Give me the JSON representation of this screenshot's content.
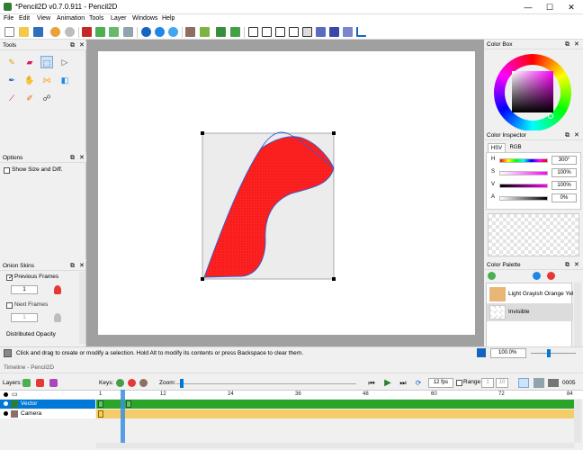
{
  "window": {
    "title": "*Pencil2D v0.7.0.911 - Pencil2D",
    "minimize": "—",
    "maximize": "☐",
    "close": "✕"
  },
  "menu": {
    "items": [
      "File",
      "Edit",
      "View",
      "Animation",
      "Tools",
      "Layer",
      "Windows",
      "Help"
    ]
  },
  "toolbar": {
    "icons": [
      "new-file-icon",
      "open-file-icon",
      "save-icon",
      "undo-icon",
      "redo-icon",
      "cut-icon",
      "copy-icon",
      "paste-icon",
      "crop-icon",
      "zoom-in-icon",
      "zoom-out-icon",
      "rotate-icon",
      "flip-horizontal-icon",
      "flip-vertical-icon",
      "grid-icon",
      "grid-quarter-icon",
      "grid-thirds-icon",
      "grid-center-icon",
      "overlay-icon",
      "onion-skin-prev-icon",
      "onion-skin-next-icon",
      "camera-path-icon"
    ]
  },
  "tools": {
    "title": "Tools",
    "items": [
      "pencil-icon",
      "eraser-icon",
      "select-icon",
      "move-icon",
      "pen-icon",
      "hand-icon",
      "polyline-icon",
      "bucket-icon",
      "eyedropper-icon",
      "brush-icon",
      "smudge-icon"
    ]
  },
  "options": {
    "title": "Options",
    "show_size": "Show Size and Diff."
  },
  "onion": {
    "title": "Onion Skins",
    "previous": "Previous Frames",
    "prev_value": "1",
    "next": "Next Frames",
    "next_value": "1",
    "distributed": "Distributed Opacity"
  },
  "colorbox": {
    "title": "Color Box"
  },
  "inspector": {
    "title": "Color Inspector",
    "tab_hsv": "HSV",
    "tab_rgb": "RGB",
    "h_label": "H",
    "h_value": "300°",
    "s_label": "S",
    "s_value": "100%",
    "v_label": "V",
    "v_value": "100%",
    "a_label": "A",
    "a_value": "0%"
  },
  "palette": {
    "title": "Color Palette",
    "items": [
      {
        "name": "Light Grayish Orange Yel",
        "color": "#e8b777"
      },
      {
        "name": "Invisible",
        "color": "transparent"
      }
    ]
  },
  "status": {
    "message": "Click and drag to create or modify a selection. Hold Alt to modify its contents or press Backspace to clear them.",
    "zoom": "100.0%"
  },
  "timeline": {
    "title": "Timeline - Pencil2D",
    "layers_label": "Layers:",
    "keys_label": "Keys:",
    "zoom_label": "Zoom:",
    "fps": "12 fps",
    "range_label": "Range",
    "range_start": "1",
    "range_end": "10",
    "frame_counter": "0005",
    "ticks": [
      "1",
      "12",
      "24",
      "36",
      "48",
      "60",
      "72",
      "84"
    ],
    "layers": [
      {
        "name": "Vector",
        "selected": true
      },
      {
        "name": "Camera",
        "selected": false
      }
    ]
  },
  "colors": {
    "shape_fill": "#ff2222",
    "accent": "#0078d7",
    "vector_track": "#2aa52a",
    "camera_track": "#f5cc6a"
  }
}
